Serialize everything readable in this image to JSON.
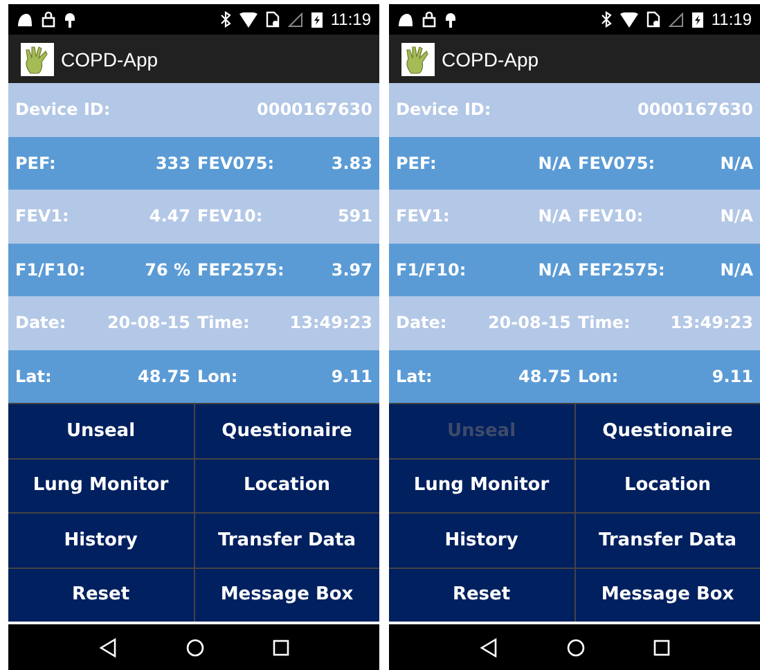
{
  "screens": [
    {
      "status_bar": {
        "time": "11:19"
      },
      "app_bar": {
        "title": "COPD-App"
      },
      "device": {
        "label": "Device ID:",
        "value": "0000167630"
      },
      "rows": [
        [
          {
            "label": "PEF:",
            "value": "333"
          },
          {
            "label": "FEV075:",
            "value": "3.83"
          }
        ],
        [
          {
            "label": "FEV1:",
            "value": "4.47"
          },
          {
            "label": "FEV10:",
            "value": "591"
          }
        ],
        [
          {
            "label": "F1/F10:",
            "value": "76 %"
          },
          {
            "label": "FEF2575:",
            "value": "3.97"
          }
        ],
        [
          {
            "label": "Date:",
            "value": "20-08-15"
          },
          {
            "label": "Time:",
            "value": "13:49:23"
          }
        ],
        [
          {
            "label": "Lat:",
            "value": "48.75"
          },
          {
            "label": "Lon:",
            "value": "9.11"
          }
        ]
      ],
      "buttons": [
        {
          "label": "Unseal",
          "disabled": false
        },
        {
          "label": "Questionaire",
          "disabled": false
        },
        {
          "label": "Lung Monitor",
          "disabled": false
        },
        {
          "label": "Location",
          "disabled": false
        },
        {
          "label": "History",
          "disabled": false
        },
        {
          "label": "Transfer Data",
          "disabled": false
        },
        {
          "label": "Reset",
          "disabled": false
        },
        {
          "label": "Message Box",
          "disabled": false
        }
      ]
    },
    {
      "status_bar": {
        "time": "11:19"
      },
      "app_bar": {
        "title": "COPD-App"
      },
      "device": {
        "label": "Device ID:",
        "value": "0000167630"
      },
      "rows": [
        [
          {
            "label": "PEF:",
            "value": "N/A"
          },
          {
            "label": "FEV075:",
            "value": "N/A"
          }
        ],
        [
          {
            "label": "FEV1:",
            "value": "N/A"
          },
          {
            "label": "FEV10:",
            "value": "N/A"
          }
        ],
        [
          {
            "label": "F1/F10:",
            "value": "N/A"
          },
          {
            "label": "FEF2575:",
            "value": "N/A"
          }
        ],
        [
          {
            "label": "Date:",
            "value": "20-08-15"
          },
          {
            "label": "Time:",
            "value": "13:49:23"
          }
        ],
        [
          {
            "label": "Lat:",
            "value": "48.75"
          },
          {
            "label": "Lon:",
            "value": "9.11"
          }
        ]
      ],
      "buttons": [
        {
          "label": "Unseal",
          "disabled": true
        },
        {
          "label": "Questionaire",
          "disabled": false
        },
        {
          "label": "Lung Monitor",
          "disabled": false
        },
        {
          "label": "Location",
          "disabled": false
        },
        {
          "label": "History",
          "disabled": false
        },
        {
          "label": "Transfer Data",
          "disabled": false
        },
        {
          "label": "Reset",
          "disabled": false
        },
        {
          "label": "Message Box",
          "disabled": false
        }
      ]
    }
  ]
}
